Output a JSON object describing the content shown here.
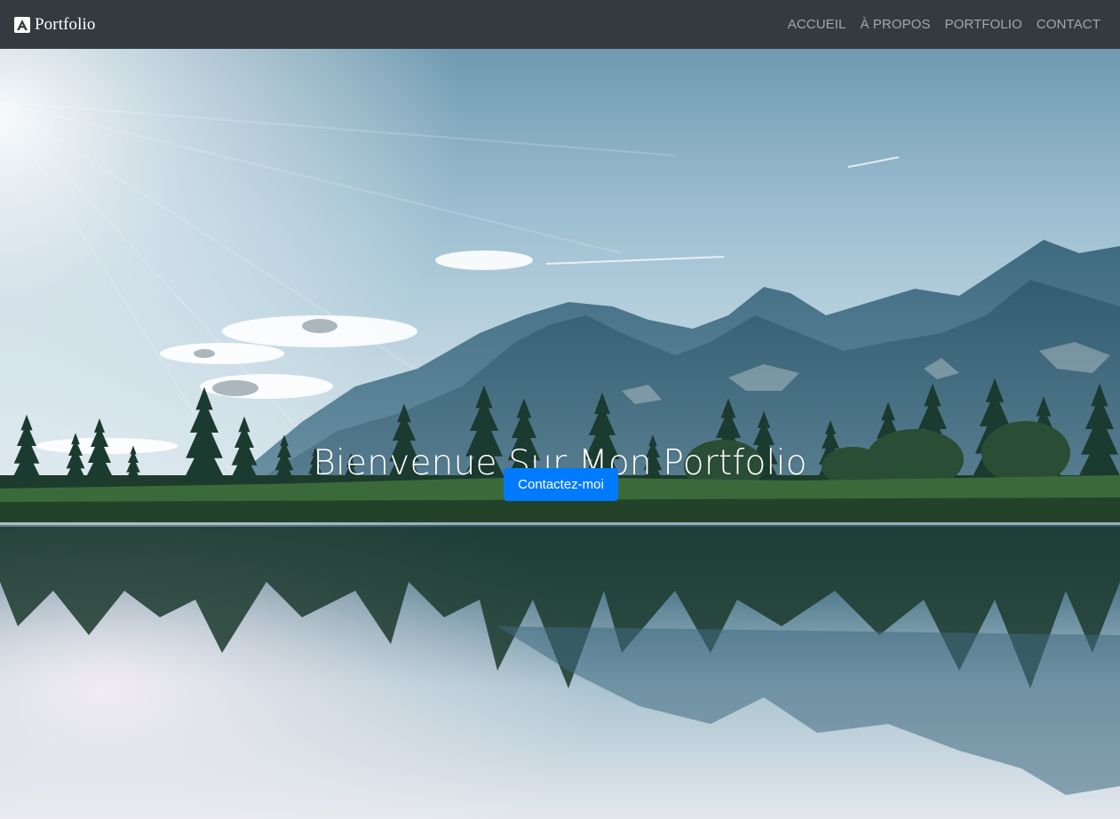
{
  "navbar": {
    "brand_label": "Portfolio",
    "brand_icon": "a-logo-icon",
    "links": [
      {
        "label": "ACCUEIL"
      },
      {
        "label": "À PROPOS"
      },
      {
        "label": "PORTFOLIO"
      },
      {
        "label": "CONTACT"
      }
    ]
  },
  "hero": {
    "title": "Bienvenue Sur Mon Portfolio",
    "cta_label": "Contactez-moi",
    "background": "mountain-lake-landscape-photo"
  },
  "colors": {
    "navbar_bg": "#343a40",
    "nav_link": "rgba(255,255,255,0.55)",
    "button_primary": "#007bff"
  }
}
